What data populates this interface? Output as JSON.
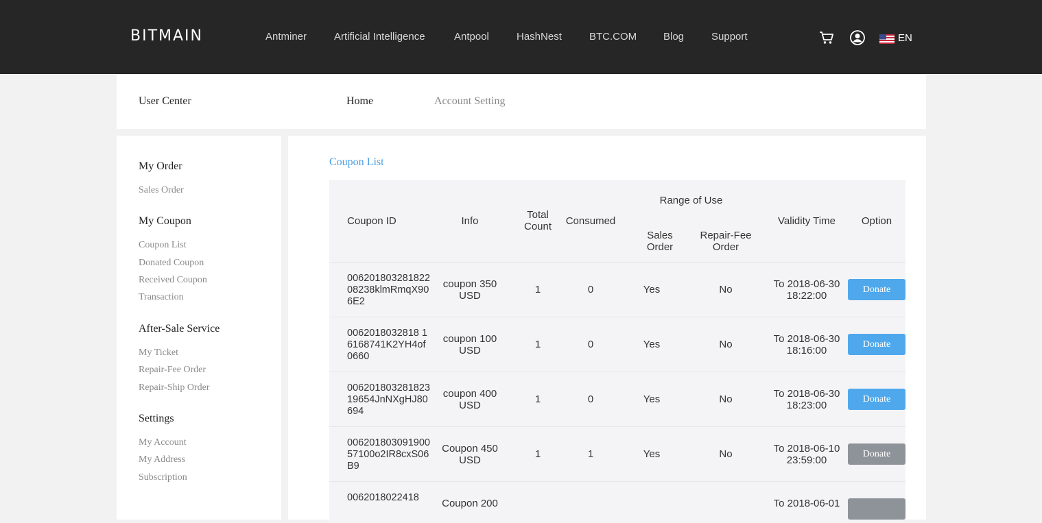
{
  "header": {
    "logo": "BITMAIN",
    "nav": [
      "Antminer",
      "Artificial Intelligence",
      "Antpool",
      "HashNest",
      "BTC.COM",
      "Blog",
      "Support"
    ],
    "lang": "EN",
    "icons": [
      "cart-icon",
      "user-icon",
      "us-flag-icon"
    ]
  },
  "subheader": {
    "title": "User Center",
    "home": "Home",
    "account": "Account Setting"
  },
  "sidebar": {
    "sections": [
      {
        "heading": "My Order",
        "items": [
          "Sales Order"
        ]
      },
      {
        "heading": "My Coupon",
        "items": [
          "Coupon List",
          "Donated Coupon",
          "Received Coupon",
          "Transaction"
        ]
      },
      {
        "heading": "After-Sale Service",
        "items": [
          "My Ticket",
          "Repair-Fee Order",
          "Repair-Ship Order"
        ]
      },
      {
        "heading": "Settings",
        "items": [
          "My Account",
          "My Address",
          "Subscription"
        ]
      }
    ]
  },
  "main": {
    "title": "Coupon List",
    "columns": {
      "coupon_id": "Coupon ID",
      "info": "Info",
      "total_count": "Total Count",
      "consumed": "Consumed",
      "range": "Range of Use",
      "sales_order": "Sales Order",
      "repair_fee_order": "Repair-Fee Order",
      "validity": "Validity Time",
      "option": "Option"
    },
    "rows": [
      {
        "id": "00620180328182208238klmRmqX906E2",
        "info": "coupon 350 USD",
        "total": "1",
        "consumed": "0",
        "sales": "Yes",
        "repair": "No",
        "validity": "To 2018-06-30 18:22:00",
        "option": "Donate",
        "enabled": true
      },
      {
        "id": "0062018032818 16168741K2YH4of0660",
        "info": "coupon 100 USD",
        "total": "1",
        "consumed": "0",
        "sales": "Yes",
        "repair": "No",
        "validity": "To 2018-06-30 18:16:00",
        "option": "Donate",
        "enabled": true
      },
      {
        "id": "00620180328182319654JnNXgHJ80694",
        "info": "coupon 400 USD",
        "total": "1",
        "consumed": "0",
        "sales": "Yes",
        "repair": "No",
        "validity": "To 2018-06-30 18:23:00",
        "option": "Donate",
        "enabled": true
      },
      {
        "id": "00620180309190057100o2IR8cxS06B9",
        "info": "Coupon 450 USD",
        "total": "1",
        "consumed": "1",
        "sales": "Yes",
        "repair": "No",
        "validity": "To 2018-06-10 23:59:00",
        "option": "Donate",
        "enabled": false
      },
      {
        "id": "0062018022418",
        "info": "Coupon 200",
        "total": "",
        "consumed": "",
        "sales": "",
        "repair": "",
        "validity": "To 2018-06-01",
        "option": "",
        "enabled": false
      }
    ]
  },
  "colors": {
    "topbar": "#262626",
    "accent": "#4a9de0",
    "button_active": "#4fa8ec",
    "button_disabled": "#8e9299"
  }
}
